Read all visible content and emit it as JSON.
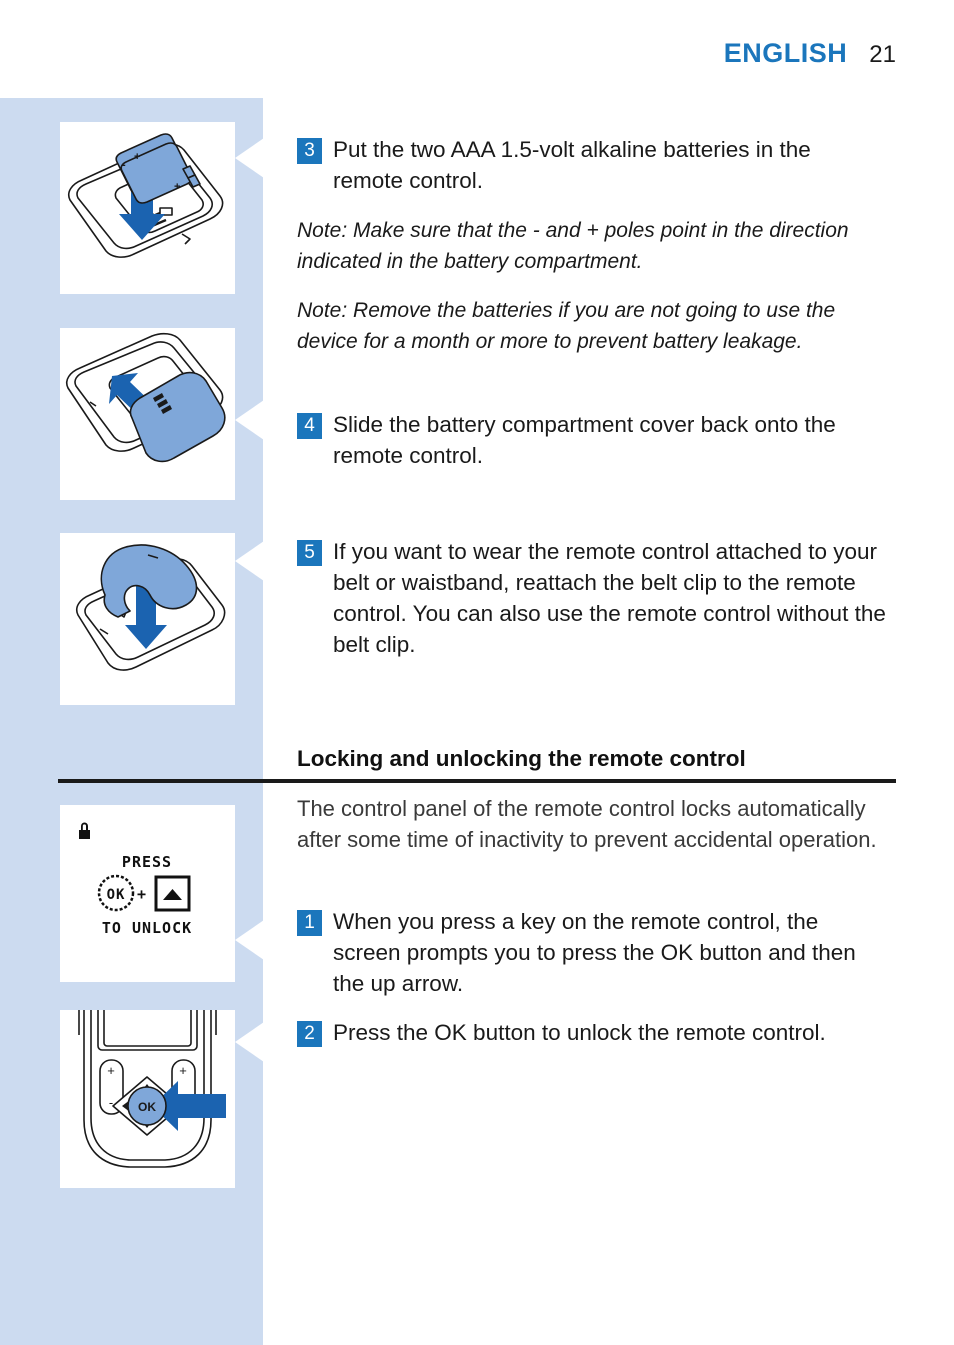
{
  "header": {
    "language": "ENGLISH",
    "page_number": "21"
  },
  "colors": {
    "accent_blue": "#1b76bc",
    "sidebar_blue": "#ccdbf0",
    "figure_blue": "#7fa7d9",
    "arrow_blue": "#1b63b0",
    "text": "#1a1a1a"
  },
  "steps": [
    {
      "number": "3",
      "text": "Put the two AAA 1.5-volt alkaline batteries in the remote control."
    },
    {
      "number": "4",
      "text": "Slide the battery compartment cover back onto the remote control."
    },
    {
      "number": "5",
      "text": "If you want to wear the remote control attached to your belt or waistband, reattach the belt clip to the remote control. You can also use the remote control without the belt clip."
    }
  ],
  "notes": [
    "Note: Make sure that the - and + poles point in the direction indicated in the battery compartment.",
    "Note: Remove the batteries if you are not going to use the device for a month or more to prevent battery leakage."
  ],
  "section": {
    "heading": "Locking and unlocking the remote control",
    "intro": "The control panel of the remote control locks automatically after some time of inactivity to prevent accidental operation.",
    "steps": [
      {
        "number": "1",
        "text": "When you press a key on the remote control, the screen prompts you to press the OK button and then the up arrow."
      },
      {
        "number": "2",
        "text": "Press the OK button to unlock the remote control."
      }
    ]
  },
  "figures": [
    {
      "id": "figure-insert-batteries",
      "caption_role": "Two AAA batteries being inserted into the open battery compartment of the remote control",
      "battery_marks": {
        "minus": "-",
        "plus": "+"
      }
    },
    {
      "id": "figure-slide-cover",
      "caption_role": "Battery compartment cover sliding back onto the remote control"
    },
    {
      "id": "figure-attach-belt-clip",
      "caption_role": "Belt clip being reattached to the back of the remote control"
    },
    {
      "id": "figure-lcd-locked-screen",
      "caption_role": "Remote control display showing the unlock prompt",
      "lcd": {
        "lock_icon": "lock-icon",
        "line1": "PRESS",
        "ok_label": "OK",
        "plus": "+",
        "arrow_key": "up-arrow-key",
        "line2": "TO UNLOCK"
      }
    },
    {
      "id": "figure-press-ok-button",
      "caption_role": "Arrow pointing at the highlighted OK button on the remote control keypad",
      "keys": {
        "ok": "OK",
        "plus_left": "+",
        "minus_left": "-",
        "plus_right": "+",
        "minus_right": "-"
      }
    }
  ]
}
